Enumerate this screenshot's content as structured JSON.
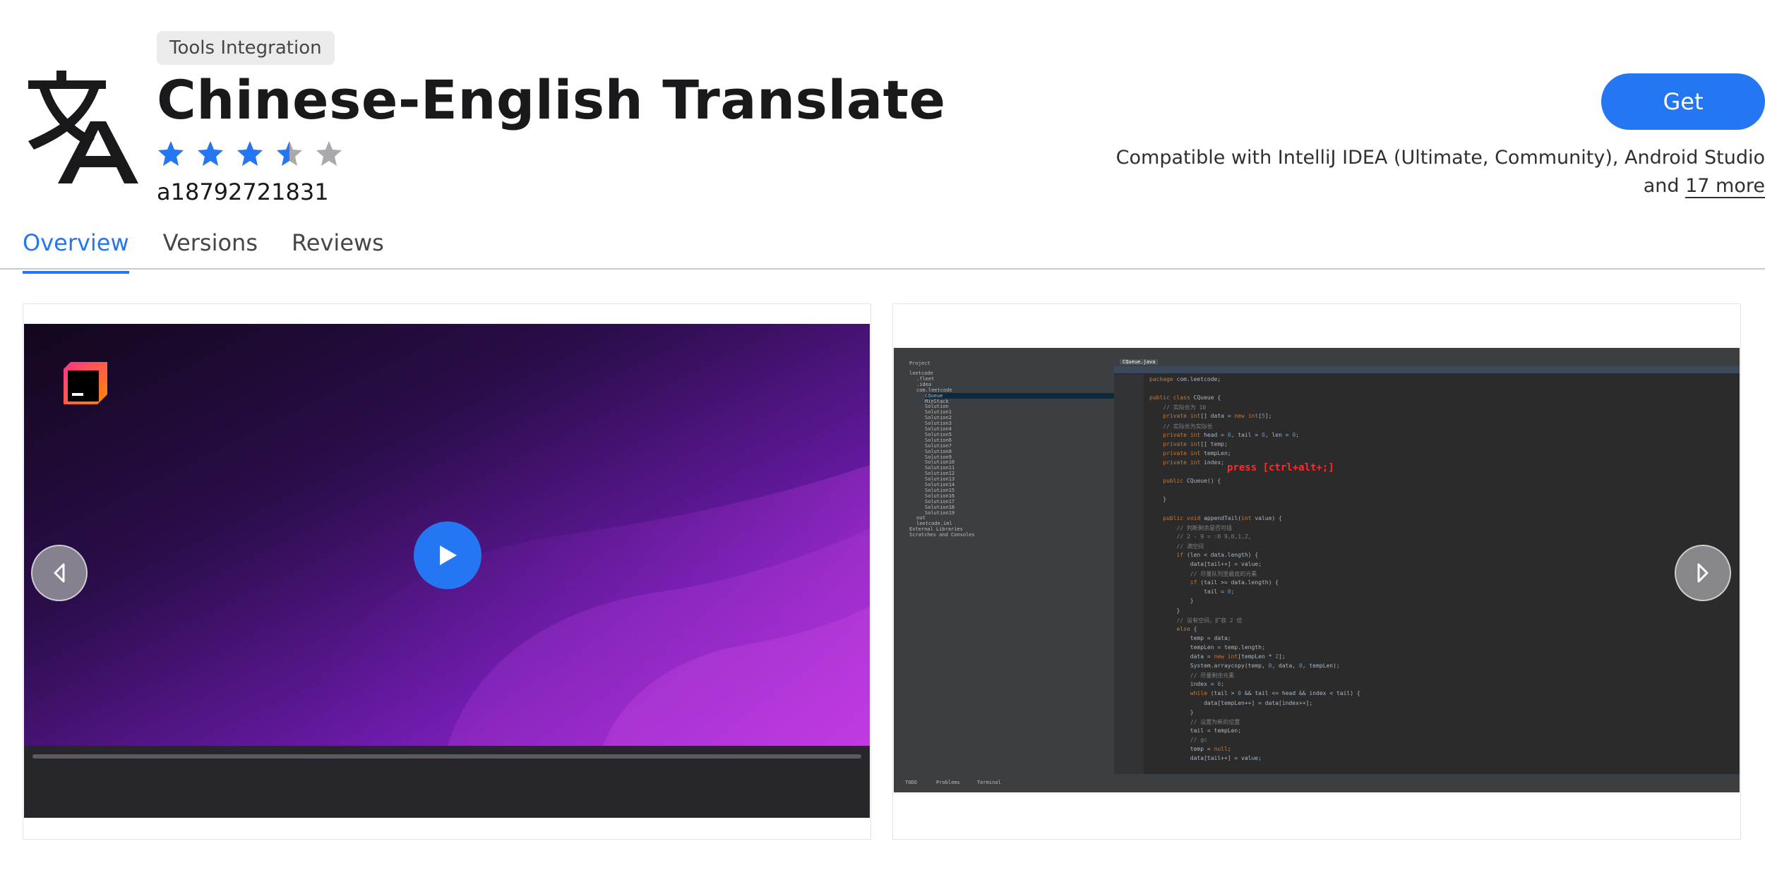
{
  "header": {
    "category": "Tools Integration",
    "title": "Chinese-English Translate",
    "vendor": "a18792721831",
    "rating": 3.5,
    "rating_max": 5,
    "get_label": "Get",
    "compat_text": "Compatible with IntelliJ IDEA (Ultimate, Community), Android Studio",
    "compat_and": "and",
    "compat_more": "17 more"
  },
  "tabs": [
    {
      "label": "Overview",
      "active": true
    },
    {
      "label": "Versions",
      "active": false
    },
    {
      "label": "Reviews",
      "active": false
    }
  ],
  "gallery": {
    "ide": {
      "project_label": "Project",
      "tree": [
        "leetcode",
        ".fleet",
        ".idea",
        "com.leetcode",
        "CQueue",
        "MinStack",
        "Solution",
        "Solution1",
        "Solution2",
        "Solution3",
        "Solution4",
        "Solution5",
        "Solution6",
        "Solution7",
        "Solution8",
        "Solution9",
        "Solution10",
        "Solution11",
        "Solution12",
        "Solution13",
        "Solution14",
        "Solution15",
        "Solution16",
        "Solution17",
        "Solution18",
        "Solution19",
        "out",
        "leetcode.iml",
        "External Libraries",
        "Scratches and Consoles"
      ],
      "file_tab": "CQueue.java",
      "code": [
        "package com.leetcode;",
        "",
        "public class CQueue {",
        "    // 实际长为 10",
        "    private int[] data = new int[5];",
        "    // 实际长为实际长",
        "    private int head = 0, tail = 0, len = 0;",
        "    private int[] temp;",
        "    private int tempLen;",
        "    private int index;",
        "",
        "    public CQueue() {",
        "",
        "    }",
        "",
        "    public void appendTail(int value) {",
        "        // 判断剩余是否可插",
        "        // 2 - 9 = :0 9,0,1,2,",
        "        // 满空间",
        "        if (len < data.length) {",
        "            data[tail++] = value;",
        "            // 尽量队列里最底的元素",
        "            if (tail >= data.length) {",
        "                tail = 0;",
        "            }",
        "        }",
        "        // 没有空间，扩容 2 倍",
        "        else {",
        "            temp = data;",
        "            tempLen = temp.length;",
        "            data = new int[tempLen * 2];",
        "            System.arraycopy(temp, 0, data, 0, tempLen);",
        "            // 尽量剩余元素",
        "            index = 0;",
        "            while (tail > 0 && tail <= head && index < tail) {",
        "                data[tempLen++] = data[index++];",
        "            }",
        "            // 设置为新的位置",
        "            tail = tempLen;",
        "            // gc",
        "            temp = null;",
        "            data[tail++] = value;"
      ],
      "hint": "press [ctrl+alt+;]",
      "bottom_tabs": [
        "TODO",
        "Problems",
        "Terminal"
      ]
    }
  },
  "colors": {
    "accent": "#2476f2",
    "star_filled": "#2476f2",
    "star_empty": "#a8a8ad"
  }
}
